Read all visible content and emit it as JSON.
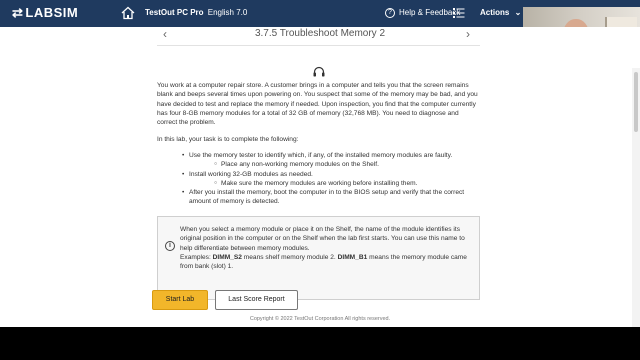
{
  "header": {
    "logo": "LABSIM",
    "product_name": "TestOut PC Pro",
    "language": "English 7.0",
    "help_label": "Help & Feedback",
    "actions_label": "Actions"
  },
  "lab": {
    "title": "3.7.5 Troubleshoot Memory 2",
    "intro": "You work at a computer repair store. A customer brings in a computer and tells you that the screen remains blank and beeps several times upon powering on. You suspect that some of the memory may be bad, and you have decided to test and replace the memory if needed. Upon inspection, you find that the computer currently has four 8-GB memory modules for a total of 32 GB of memory (32,768 MB). You need to diagnose and correct the problem.",
    "task_intro": "In this lab, your task is to complete the following:",
    "tasks": [
      {
        "text": "Use the memory tester to identify which, if any, of the installed memory modules are faulty.",
        "sub": "Place any non-working memory modules on the Shelf."
      },
      {
        "text": "Install working 32-GB modules as needed.",
        "sub": "Make sure the memory modules are working before installing them."
      },
      {
        "text": "After you install the memory, boot the computer in to the BIOS setup and verify that the correct amount of memory is detected.",
        "sub": ""
      }
    ],
    "info": {
      "line1": "When you select a memory module or place it on the Shelf, the name of the module identifies its original position in the computer or on the Shelf when the lab first starts. You can use this name to help differentiate between memory modules.",
      "examples_prefix": "Examples: ",
      "example1_code": "DIMM_S2",
      "example1_text": " means shelf memory module 2. ",
      "example2_code": "DIMM_B1",
      "example2_text": " means the memory module came from bank (slot) 1."
    },
    "start_button": "Start Lab",
    "score_button": "Last Score Report",
    "copyright": "Copyright © 2022 TestOut Corporation  All rights reserved."
  },
  "colors": {
    "header_bg": "#1f3a5f",
    "start_button": "#f2b62a"
  }
}
